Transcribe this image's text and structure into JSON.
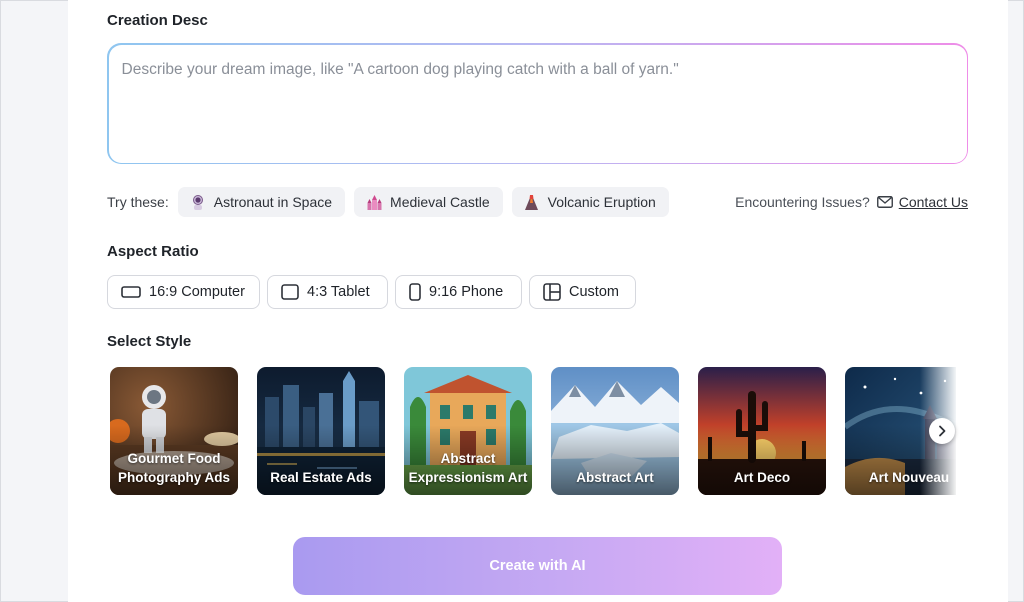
{
  "creation_desc": {
    "title": "Creation Desc",
    "placeholder": "Describe your dream image, like \"A cartoon dog playing catch with a ball of yarn.\""
  },
  "try_these": {
    "label": "Try these:",
    "chips": [
      {
        "label": "Astronaut in Space",
        "icon": "astronaut-icon"
      },
      {
        "label": "Medieval Castle",
        "icon": "castle-icon"
      },
      {
        "label": "Volcanic Eruption",
        "icon": "volcano-icon"
      }
    ]
  },
  "issues": {
    "text": "Encountering Issues?",
    "link": "Contact Us"
  },
  "aspect_ratio": {
    "title": "Aspect Ratio",
    "options": [
      {
        "label": "16:9 Computer",
        "icon": "landscape-rect-icon"
      },
      {
        "label": "4:3 Tablet",
        "icon": "square-rect-icon"
      },
      {
        "label": "9:16 Phone",
        "icon": "portrait-rect-icon"
      },
      {
        "label": "Custom",
        "icon": "layout-grid-icon"
      }
    ]
  },
  "select_style": {
    "title": "Select Style",
    "styles": [
      {
        "line1": "Gourmet Food",
        "line2": "Photography Ads"
      },
      {
        "line1": "Real Estate Ads",
        "line2": ""
      },
      {
        "line1": "Abstract",
        "line2": "Expressionism Art"
      },
      {
        "line1": "Abstract Art",
        "line2": ""
      },
      {
        "line1": "Art Deco",
        "line2": ""
      },
      {
        "line1": "Art Nouveau",
        "line2": ""
      }
    ]
  },
  "create_button": {
    "label": "Create with AI"
  },
  "colors": {
    "gradient_start": "#a99af0",
    "gradient_end": "#e2b0f7",
    "input_border_start": "#8fc6f0",
    "input_border_end": "#ee8de8"
  }
}
